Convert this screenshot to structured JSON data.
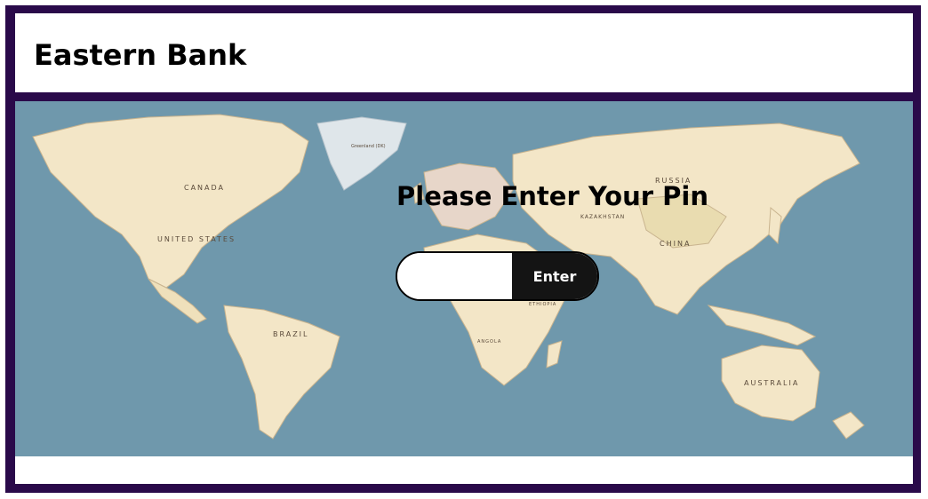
{
  "header": {
    "bank_name": "Eastern Bank"
  },
  "login": {
    "prompt": "Please Enter Your Pin",
    "pin_value": "",
    "pin_placeholder": "",
    "enter_label": "Enter"
  },
  "map": {
    "labels": {
      "canada": "CANADA",
      "united_states": "UNITED STATES",
      "brazil": "BRAZIL",
      "russia": "RUSSIA",
      "china": "CHINA",
      "kazakhstan": "KAZAKHSTAN",
      "australia": "AUSTRALIA",
      "greenland": "Greenland (DK)",
      "ethiopia": "ETHIOPIA",
      "angola": "ANGOLA"
    }
  },
  "colors": {
    "frame": "#2a0a4a",
    "ocean": "#6f98ac",
    "land": "#f3e6c7",
    "button": "#141414"
  }
}
